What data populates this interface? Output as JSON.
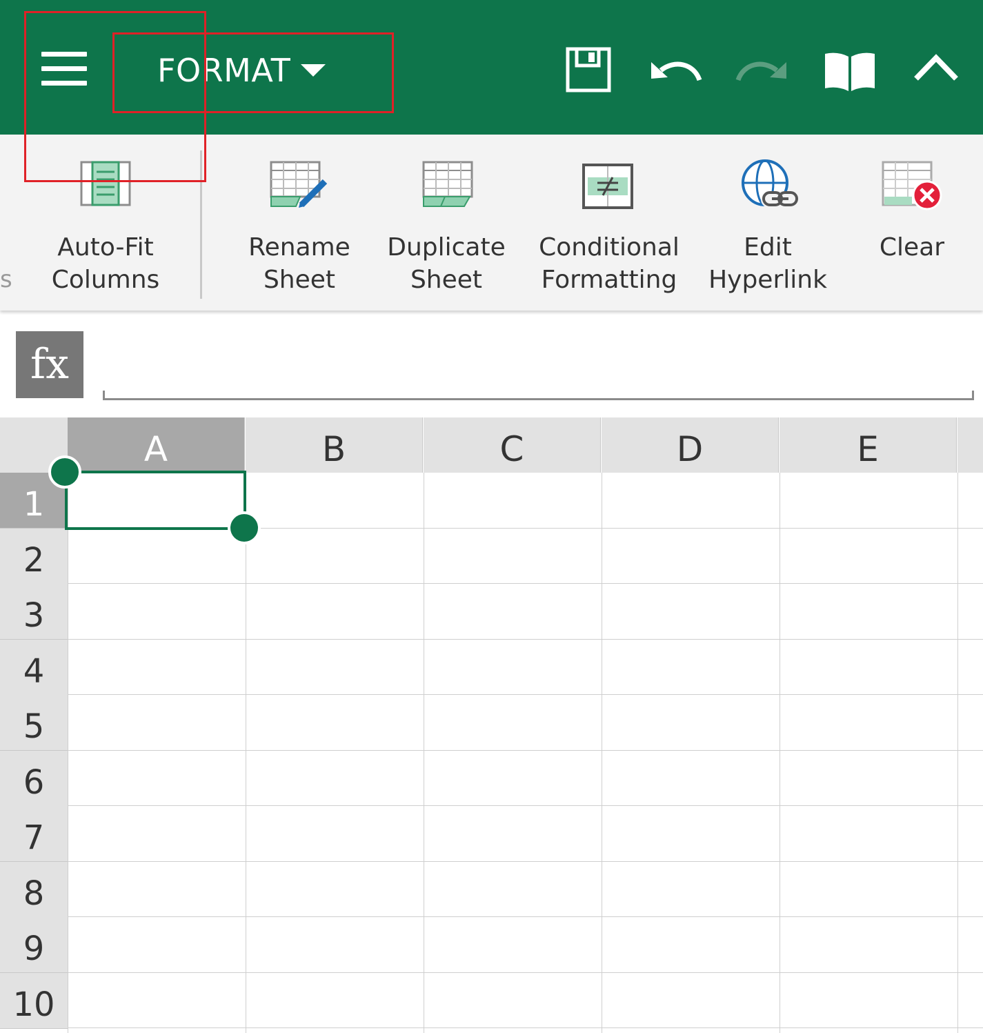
{
  "toolbar": {
    "menu_label": "FORMAT",
    "icons": [
      "menu-icon",
      "save-icon",
      "undo-icon",
      "redo-icon",
      "read-mode-icon",
      "collapse-icon"
    ],
    "accent": "#0e754b"
  },
  "ribbon": {
    "partial_label": "s",
    "items": [
      {
        "line1": "Auto-Fit",
        "line2": "Columns",
        "icon": "auto-fit-columns-icon"
      },
      {
        "line1": "Rename",
        "line2": "Sheet",
        "icon": "rename-sheet-icon"
      },
      {
        "line1": "Duplicate",
        "line2": "Sheet",
        "icon": "duplicate-sheet-icon"
      },
      {
        "line1": "Conditional",
        "line2": "Formatting",
        "icon": "conditional-formatting-icon"
      },
      {
        "line1": "Edit",
        "line2": "Hyperlink",
        "icon": "edit-hyperlink-icon"
      },
      {
        "line1": "Clear",
        "line2": "",
        "icon": "clear-icon"
      }
    ]
  },
  "formula_bar": {
    "fx_label": "fx",
    "value": ""
  },
  "sheet": {
    "columns": [
      "A",
      "B",
      "C",
      "D",
      "E"
    ],
    "rows": [
      "1",
      "2",
      "3",
      "4",
      "5",
      "6",
      "7",
      "8",
      "9",
      "10"
    ],
    "selected_cell": "A1"
  }
}
